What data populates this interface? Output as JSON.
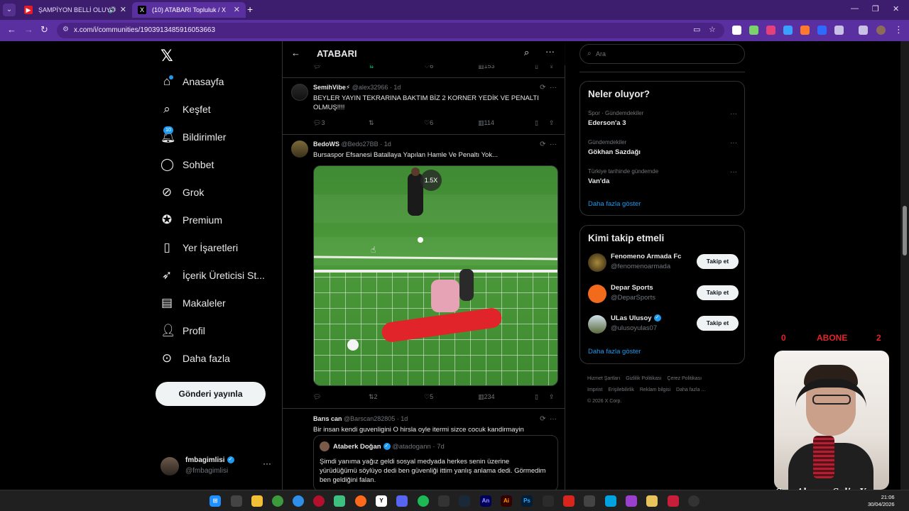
{
  "browser": {
    "tabs": [
      {
        "title": "ŞAMPİYON BELLİ OLUYO",
        "close": "✕"
      },
      {
        "title": "(10) ATABARI Topluluk / X",
        "close": "✕"
      }
    ],
    "new_tab": "+",
    "url": "x.com/i/communities/1903913485916053663"
  },
  "sidebar": {
    "logo": "𝕏",
    "items": [
      {
        "label": "Anasayfa",
        "icon": "home-icon"
      },
      {
        "label": "Keşfet",
        "icon": "search-icon"
      },
      {
        "label": "Bildirimler",
        "icon": "bell-icon",
        "badge": "10"
      },
      {
        "label": "Sohbet",
        "icon": "chat-icon"
      },
      {
        "label": "Grok",
        "icon": "grok-icon"
      },
      {
        "label": "Premium",
        "icon": "premium-icon"
      },
      {
        "label": "Yer İşaretleri",
        "icon": "bookmark-icon"
      },
      {
        "label": "İçerik Üreticisi St...",
        "icon": "rocket-icon"
      },
      {
        "label": "Makaleler",
        "icon": "article-icon"
      },
      {
        "label": "Profil",
        "icon": "profile-icon"
      },
      {
        "label": "Daha fazla",
        "icon": "more-circle-icon"
      }
    ],
    "post_button": "Gönderi yayınla",
    "account": {
      "name": "fmbagimlisi",
      "handle": "@fmbagimlisi",
      "more": "···"
    }
  },
  "timeline": {
    "title": "ATABARI",
    "top_actions": {
      "retweets": "",
      "likes": "6",
      "views": "153"
    },
    "posts": [
      {
        "name": "SemihVibe⚡",
        "handle": "@alex32966",
        "time": "· 1d",
        "text": "BEYLER YAYIN TEKRARINA BAKTIM BİZ 2 KORNER YEDİK VE PENALTI OLMUŞ!!!!",
        "replies": "3",
        "retweets": "",
        "likes": "6",
        "views": "114"
      },
      {
        "name": "BedoWS",
        "handle": "@Bedo27BB",
        "time": "· 1d",
        "text": "Bursaspor Efsanesi Batallaya Yapılan Hamle Ve Penaltı Yok...",
        "speed": "1.5X",
        "replies": "",
        "retweets": "2",
        "likes": "5",
        "views": "234"
      },
      {
        "name": "Barıs can",
        "handle": "@Barscan282805",
        "time": "· 1d",
        "text": "Bir insan kendi guvenligini O hirsla oyle itermi sizce cocuk kandirmayin",
        "quote": {
          "name": "Ataberk Doğan",
          "handle": "@atadogann",
          "time": "· 7d",
          "text": "Şimdi yanıma yağız geldi sosyal medyada herkes senin üzerine yürüdüğümü söylüyo dedi ben güvenliği ittim yanlış anlama dedi. Görmedim ben geldiğini falan."
        }
      }
    ]
  },
  "right": {
    "search_placeholder": "Ara",
    "trends_title": "Neler oluyor?",
    "trends": [
      {
        "context": "Spor · Gündemdekiler",
        "name": "Ederson'a 3"
      },
      {
        "context": "Gündemdekiler",
        "name": "Gökhan Sazdağı"
      },
      {
        "context": "Türkiye tarihinde gündemde",
        "name": "Van'da"
      }
    ],
    "trends_more": "Daha fazla göster",
    "follow_title": "Kimi takip etmeli",
    "follow": [
      {
        "name": "Fenomeno Armada Fc",
        "handle": "@fenomenoarmada",
        "button": "Takip et"
      },
      {
        "name": "Depar Sports",
        "handle": "@DeparSports",
        "button": "Takip et"
      },
      {
        "name": "ULas Ulusoy",
        "handle": "@ulusoyulas07",
        "button": "Takip et"
      }
    ],
    "follow_more": "Daha fazla göster",
    "footer": [
      "Hizmet Şartları",
      "Gizlilik Politikası",
      "Çerez Politikası",
      "Imprint",
      "Erişilebilirlik",
      "Reklam bilgisi",
      "Daha fazla ...",
      "© 2026 X Corp."
    ]
  },
  "overlay": {
    "left_count": "0",
    "label": "ABONE",
    "right_count": "2",
    "signature": "Son Abone: SalimYavuz"
  },
  "taskbar": {
    "time": "21:06",
    "date": "30/04/2026"
  },
  "colors": {
    "accent": "#1d9bf0",
    "browser_frame": "#5a2fa0",
    "overlay_red": "#e0242a"
  }
}
